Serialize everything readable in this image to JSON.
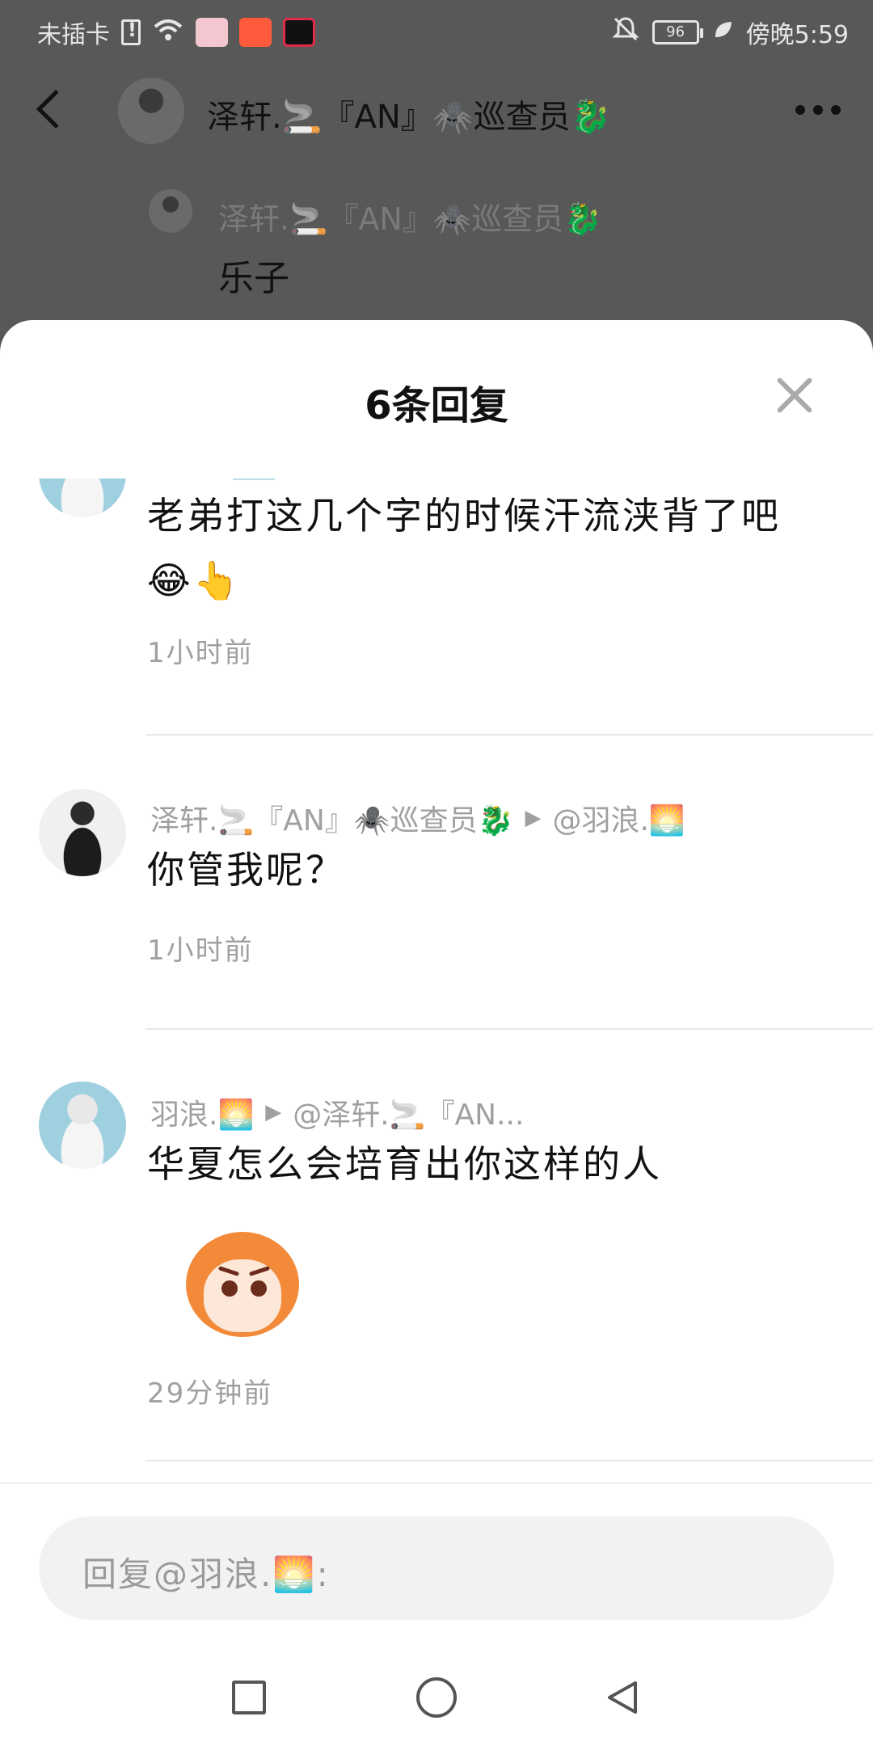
{
  "status_bar": {
    "carrier": "未插卡",
    "battery": "96",
    "time": "傍晚5:59",
    "icons": [
      "sim-alert-icon",
      "wifi-icon",
      "app-icon-1",
      "app-icon-2",
      "app-icon-3",
      "bell-off-icon",
      "battery-icon",
      "leaf-icon"
    ]
  },
  "background_page": {
    "header_name": "泽轩.🚬『AN』🕷️巡查员🐉",
    "comment_author": "泽轩.🚬『AN』🕷️巡查员🐉",
    "comment_text": "乐子"
  },
  "sheet": {
    "title": "6条回复",
    "close_icon": "close-icon"
  },
  "replies": [
    {
      "text": "老弟打这几个字的时候汗流浃背了吧 😂👆",
      "time": "1小时前"
    },
    {
      "author": "泽轩.🚬『AN』🕷️巡查员🐉",
      "reply_to": "@羽浪.🌅",
      "text": "你管我呢？",
      "time": "1小时前"
    },
    {
      "author": "羽浪.🌅",
      "reply_to": "@泽轩.🚬『AN...",
      "text": "华夏怎么会培育出你这样的人",
      "sticker": "angry-face-sticker",
      "time": "29分钟前"
    }
  ],
  "input": {
    "placeholder": "回复@羽浪.🌅:"
  },
  "colors": {
    "dim_overlay": "#585858",
    "sheet_bg": "#ffffff",
    "meta_gray": "#a0a0a0",
    "input_bg": "#f2f2f2"
  }
}
